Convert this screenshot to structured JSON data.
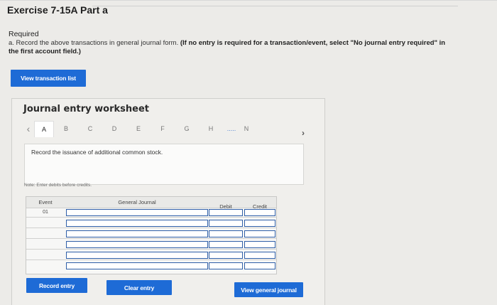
{
  "header": {
    "title": "Exercise 7-15A Part a"
  },
  "required": {
    "label": "Required",
    "text_plain": "a. Record the above transactions in general journal form.",
    "text_bold": "(If no entry is required for a transaction/event, select \"No journal entry required\" in the first account field.)"
  },
  "buttons": {
    "view_transaction_list": "View transaction list",
    "record_entry": "Record entry",
    "clear_entry": "Clear entry",
    "view_general_journal": "View general journal"
  },
  "worksheet": {
    "title": "Journal entry worksheet",
    "tabs": [
      "A",
      "B",
      "C",
      "D",
      "E",
      "F",
      "G",
      "H",
      ".....",
      "N"
    ],
    "active_tab": "A",
    "description": "Record the issuance of additional common stock.",
    "note": "Note: Enter debits before credits.",
    "columns": {
      "event": "Event",
      "general_journal": "General Journal",
      "debit": "Debit",
      "credit": "Credit"
    },
    "rows": [
      {
        "event": "01"
      },
      {
        "event": ""
      },
      {
        "event": ""
      },
      {
        "event": ""
      },
      {
        "event": ""
      },
      {
        "event": ""
      }
    ]
  },
  "icons": {
    "prev": "chevron-left-icon",
    "next": "chevron-right-icon"
  },
  "colors": {
    "button_blue": "#1e6bd6",
    "input_border": "#2f5fa8"
  }
}
